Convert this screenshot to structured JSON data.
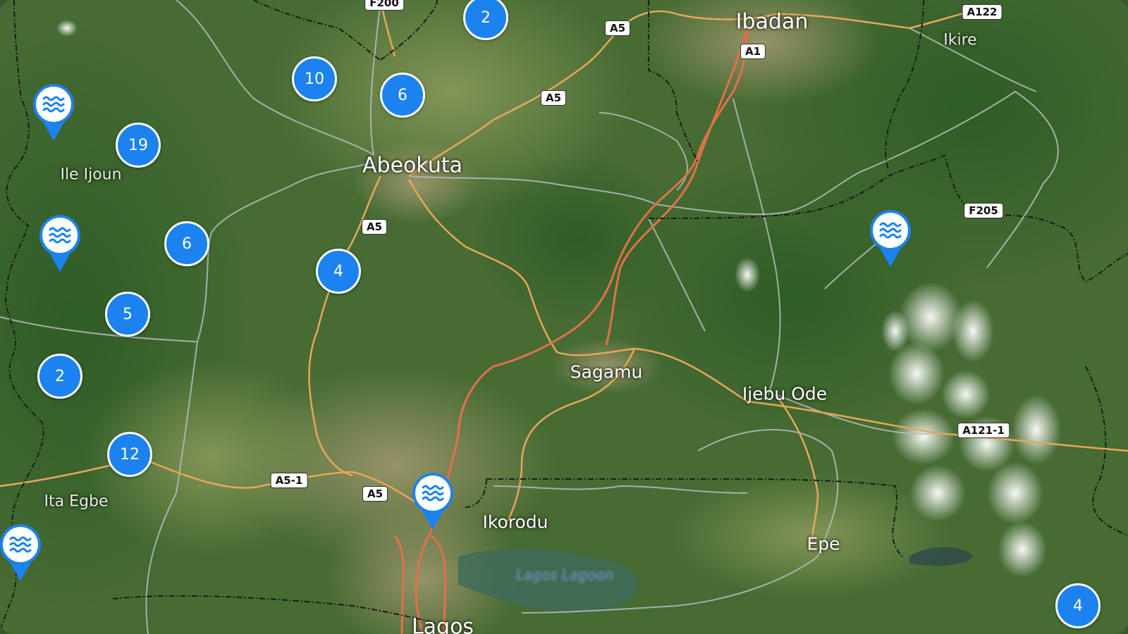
{
  "map": {
    "cities": [
      {
        "name": "Ibadan",
        "size": "big"
      },
      {
        "name": "Abeokuta",
        "size": "big"
      },
      {
        "name": "Sagamu",
        "size": "med"
      },
      {
        "name": "Ijebu Ode",
        "size": "med"
      },
      {
        "name": "Ikorodu",
        "size": "med"
      },
      {
        "name": "Epe",
        "size": "med"
      },
      {
        "name": "Lagos",
        "size": "big"
      },
      {
        "name": "Ikire",
        "size": "small"
      },
      {
        "name": "Ile Ijoun",
        "size": "small"
      },
      {
        "name": "Ita Egbe",
        "size": "small"
      }
    ],
    "water_label": "Lagos Lagoon",
    "road_shields": [
      "F200",
      "A5",
      "A122",
      "A1",
      "A5",
      "A5",
      "F205",
      "A121-1",
      "A5-1",
      "A5"
    ],
    "clusters": [
      2,
      10,
      6,
      19,
      6,
      4,
      5,
      2,
      12,
      4
    ],
    "water_marker_icon": "water-waves-icon",
    "colors": {
      "cluster_fill": "#1b82ef",
      "pin_fill": "#1b82ef",
      "highway": "#e8a65a",
      "primary_road": "#e3704a",
      "minor_road": "#b8bcbc",
      "boundary": "#1c1c1c"
    }
  }
}
